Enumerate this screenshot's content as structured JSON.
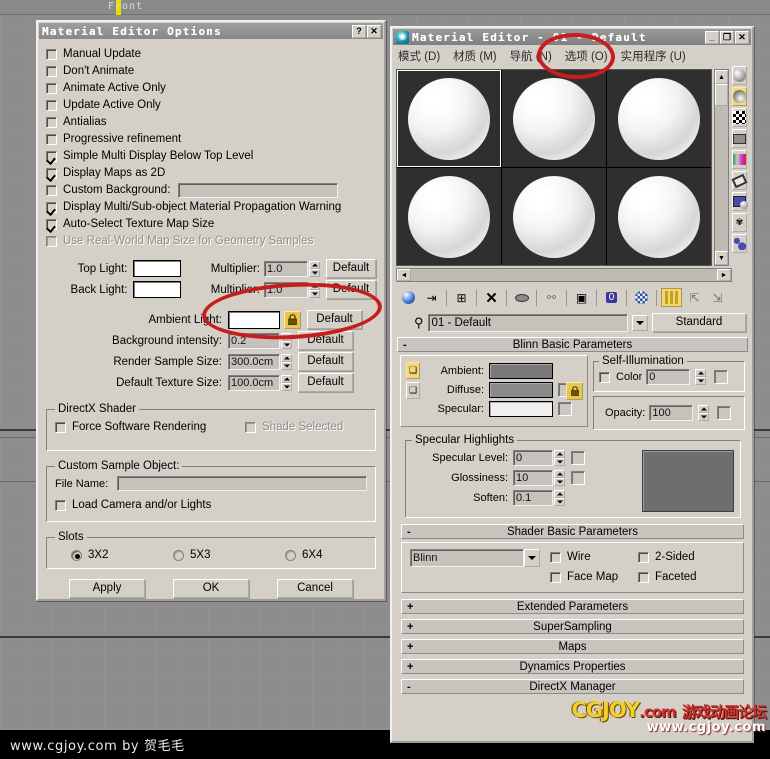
{
  "viewport": {
    "label": "Front",
    "footer": "www.cgjoy.com by 贺毛毛"
  },
  "options_dialog": {
    "title": "Material Editor Options",
    "help_button": "?",
    "close_button": "✕",
    "checkboxes": [
      {
        "label": "Manual Update",
        "checked": false,
        "disabled": false
      },
      {
        "label": "Don't Animate",
        "checked": false,
        "disabled": false
      },
      {
        "label": "Animate Active Only",
        "checked": false,
        "disabled": false
      },
      {
        "label": "Update Active Only",
        "checked": false,
        "disabled": false
      },
      {
        "label": "Antialias",
        "checked": false,
        "disabled": false
      },
      {
        "label": "Progressive refinement",
        "checked": false,
        "disabled": false
      },
      {
        "label": "Simple Multi Display Below Top Level",
        "checked": true,
        "disabled": false
      },
      {
        "label": "Display Maps as 2D",
        "checked": true,
        "disabled": false
      },
      {
        "label": "Custom Background:",
        "checked": false,
        "disabled": false
      },
      {
        "label": "Display Multi/Sub-object Material Propagation Warning",
        "checked": true,
        "disabled": false
      },
      {
        "label": "Auto-Select Texture Map Size",
        "checked": true,
        "disabled": false
      },
      {
        "label": "Use Real-World Map Size for Geometry Samples",
        "checked": false,
        "disabled": true
      }
    ],
    "lights": [
      {
        "caption": "Top Light:",
        "multiplier_label": "Multiplier:",
        "multiplier": "1.0",
        "default_label": "Default",
        "swatch_color": "#ffffff"
      },
      {
        "caption": "Back Light:",
        "multiplier_label": "Multiplier:",
        "multiplier": "1.0",
        "default_label": "Default",
        "swatch_color": "#ffffff"
      }
    ],
    "ambient": {
      "caption": "Ambient Light:",
      "swatch_color": "#ffffff",
      "lock_icon": "lock-icon",
      "default_label": "Default"
    },
    "numeric_rows": [
      {
        "caption": "Background intensity:",
        "value": "0.2",
        "default_label": "Default"
      },
      {
        "caption": "Render Sample Size:",
        "value": "300.0cm",
        "default_label": "Default"
      },
      {
        "caption": "Default Texture Size:",
        "value": "100.0cm",
        "default_label": "Default"
      }
    ],
    "directx_group": {
      "legend": "DirectX Shader",
      "force_software": "Force Software Rendering",
      "shade_selected": "Shade Selected"
    },
    "custom_sample_group": {
      "legend": "Custom Sample Object:",
      "file_name_label": "File Name:",
      "file_name_value": "",
      "load_camera": "Load Camera and/or Lights"
    },
    "slots_group": {
      "legend": "Slots",
      "options": [
        {
          "label": "3X2",
          "selected": true
        },
        {
          "label": "5X3",
          "selected": false
        },
        {
          "label": "6X4",
          "selected": false
        }
      ]
    },
    "buttons": {
      "apply": "Apply",
      "ok": "OK",
      "cancel": "Cancel"
    }
  },
  "material_editor": {
    "title": "Material Editor - 01 - Default",
    "app_icon": "material-editor-icon",
    "window_buttons": {
      "minimize": "_",
      "maximize": "❐",
      "close": "✕"
    },
    "menu": [
      "模式 (D)",
      "材质 (M)",
      "导航 (N)",
      "选项 (O)",
      "实用程序 (U)"
    ],
    "slots": [
      {
        "name": "slot-1",
        "active": true
      },
      {
        "name": "slot-2",
        "active": false
      },
      {
        "name": "slot-3",
        "active": false
      },
      {
        "name": "slot-4",
        "active": false
      },
      {
        "name": "slot-5",
        "active": false
      },
      {
        "name": "slot-6",
        "active": false
      }
    ],
    "toolbar_icons": [
      "get-material-icon",
      "put-material-to-scene-icon",
      "assign-material-icon",
      "reset-map-icon",
      "make-material-copy-icon",
      "make-unique-icon",
      "put-to-library-icon",
      "material-effects-channel-icon",
      "show-map-in-viewport-icon",
      "show-end-result-icon",
      "go-to-parent-icon",
      "go-forward-to-sibling-icon"
    ],
    "side_icons": [
      "sample-type-sphere-icon",
      "backlight-icon",
      "background-checker-icon",
      "sample-uv-tiling-icon",
      "video-color-check-icon",
      "make-preview-icon",
      "options-icon",
      "select-by-material-icon",
      "material-map-navigator-icon"
    ],
    "material_name": "01 - Default",
    "material_type": "Standard",
    "eyedropper_icon": "eyedropper-icon",
    "blinn_panel": {
      "title": "Blinn Basic Parameters",
      "lock_ambient_diffuse_icon": "lock-icon",
      "rows": [
        {
          "label": "Ambient:",
          "color": "#787878"
        },
        {
          "label": "Diffuse:",
          "color": "#8a8a8a"
        },
        {
          "label": "Specular:",
          "color": "#f0efed"
        }
      ],
      "self_illumination": {
        "legend": "Self-Illumination",
        "color_label": "Color",
        "color_value": "0"
      },
      "opacity": {
        "label": "Opacity:",
        "value": "100"
      }
    },
    "specular_panel": {
      "legend": "Specular Highlights",
      "rows": [
        {
          "label": "Specular Level:",
          "value": "0"
        },
        {
          "label": "Glossiness:",
          "value": "10"
        },
        {
          "label": "Soften:",
          "value": "0.1"
        }
      ],
      "curve_bg": "#6e6e6e"
    },
    "shader_panel": {
      "title": "Shader Basic Parameters",
      "shader": "Blinn",
      "checkboxes": [
        {
          "label": "Wire",
          "checked": false
        },
        {
          "label": "2-Sided",
          "checked": false
        },
        {
          "label": "Face Map",
          "checked": false
        },
        {
          "label": "Faceted",
          "checked": false
        }
      ]
    },
    "rollouts": [
      {
        "label": "Extended Parameters",
        "state": "+"
      },
      {
        "label": "SuperSampling",
        "state": "+"
      },
      {
        "label": "Maps",
        "state": "+"
      },
      {
        "label": "Dynamics Properties",
        "state": "+"
      },
      {
        "label": "DirectX Manager",
        "state": "-"
      }
    ]
  },
  "watermark": {
    "line1_main": "CGJOY",
    "line1_suffix": ".com",
    "line1_cn": "游戏动画论坛",
    "line2": "www.cgjoy.com"
  },
  "annotations": [
    {
      "name": "ambient-light-highlight",
      "color": "#c81d1d"
    },
    {
      "name": "options-menu-highlight",
      "color": "#c81d1d"
    }
  ]
}
